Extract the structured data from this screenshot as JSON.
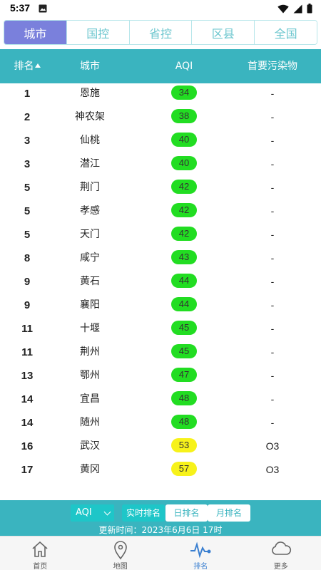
{
  "status_bar": {
    "time": "5:37"
  },
  "tabs": [
    {
      "label": "城市",
      "active": true
    },
    {
      "label": "国控",
      "active": false
    },
    {
      "label": "省控",
      "active": false
    },
    {
      "label": "区县",
      "active": false
    },
    {
      "label": "全国",
      "active": false
    }
  ],
  "table": {
    "headers": {
      "rank": "排名",
      "city": "城市",
      "aqi": "AQI",
      "pollutant": "首要污染物"
    },
    "rows": [
      {
        "rank": "1",
        "city": "恩施",
        "aqi": "34",
        "pollutant": "-",
        "color": "#22dd22"
      },
      {
        "rank": "2",
        "city": "神农架",
        "aqi": "38",
        "pollutant": "-",
        "color": "#22dd22"
      },
      {
        "rank": "3",
        "city": "仙桃",
        "aqi": "40",
        "pollutant": "-",
        "color": "#22dd22"
      },
      {
        "rank": "3",
        "city": "潜江",
        "aqi": "40",
        "pollutant": "-",
        "color": "#22dd22"
      },
      {
        "rank": "5",
        "city": "荆门",
        "aqi": "42",
        "pollutant": "-",
        "color": "#22dd22"
      },
      {
        "rank": "5",
        "city": "孝感",
        "aqi": "42",
        "pollutant": "-",
        "color": "#22dd22"
      },
      {
        "rank": "5",
        "city": "天门",
        "aqi": "42",
        "pollutant": "-",
        "color": "#22dd22"
      },
      {
        "rank": "8",
        "city": "咸宁",
        "aqi": "43",
        "pollutant": "-",
        "color": "#22dd22"
      },
      {
        "rank": "9",
        "city": "黄石",
        "aqi": "44",
        "pollutant": "-",
        "color": "#22dd22"
      },
      {
        "rank": "9",
        "city": "襄阳",
        "aqi": "44",
        "pollutant": "-",
        "color": "#22dd22"
      },
      {
        "rank": "11",
        "city": "十堰",
        "aqi": "45",
        "pollutant": "-",
        "color": "#22dd22"
      },
      {
        "rank": "11",
        "city": "荆州",
        "aqi": "45",
        "pollutant": "-",
        "color": "#22dd22"
      },
      {
        "rank": "13",
        "city": "鄂州",
        "aqi": "47",
        "pollutant": "-",
        "color": "#22dd22"
      },
      {
        "rank": "14",
        "city": "宜昌",
        "aqi": "48",
        "pollutant": "-",
        "color": "#22dd22"
      },
      {
        "rank": "14",
        "city": "随州",
        "aqi": "48",
        "pollutant": "-",
        "color": "#22dd22"
      },
      {
        "rank": "16",
        "city": "武汉",
        "aqi": "53",
        "pollutant": "O3",
        "color": "#f7f21a"
      },
      {
        "rank": "17",
        "city": "黄冈",
        "aqi": "57",
        "pollutant": "O3",
        "color": "#f7f21a"
      }
    ]
  },
  "controls": {
    "metric_select": "AQI",
    "realtime_label": "实时排名",
    "daily_label": "日排名",
    "monthly_label": "月排名",
    "update_time": "更新时间：2023年6月6日 17时"
  },
  "nav": [
    {
      "label": "首页",
      "icon": "home-icon",
      "active": false
    },
    {
      "label": "地图",
      "icon": "map-pin-icon",
      "active": false
    },
    {
      "label": "排名",
      "icon": "pulse-icon",
      "active": true
    },
    {
      "label": "更多",
      "icon": "cloud-icon",
      "active": false
    }
  ],
  "colors": {
    "primary": "#3ab4bf",
    "tab_active": "#7a80dc",
    "good": "#22dd22",
    "moderate": "#f7f21a",
    "nav_active": "#3a7fd0"
  }
}
